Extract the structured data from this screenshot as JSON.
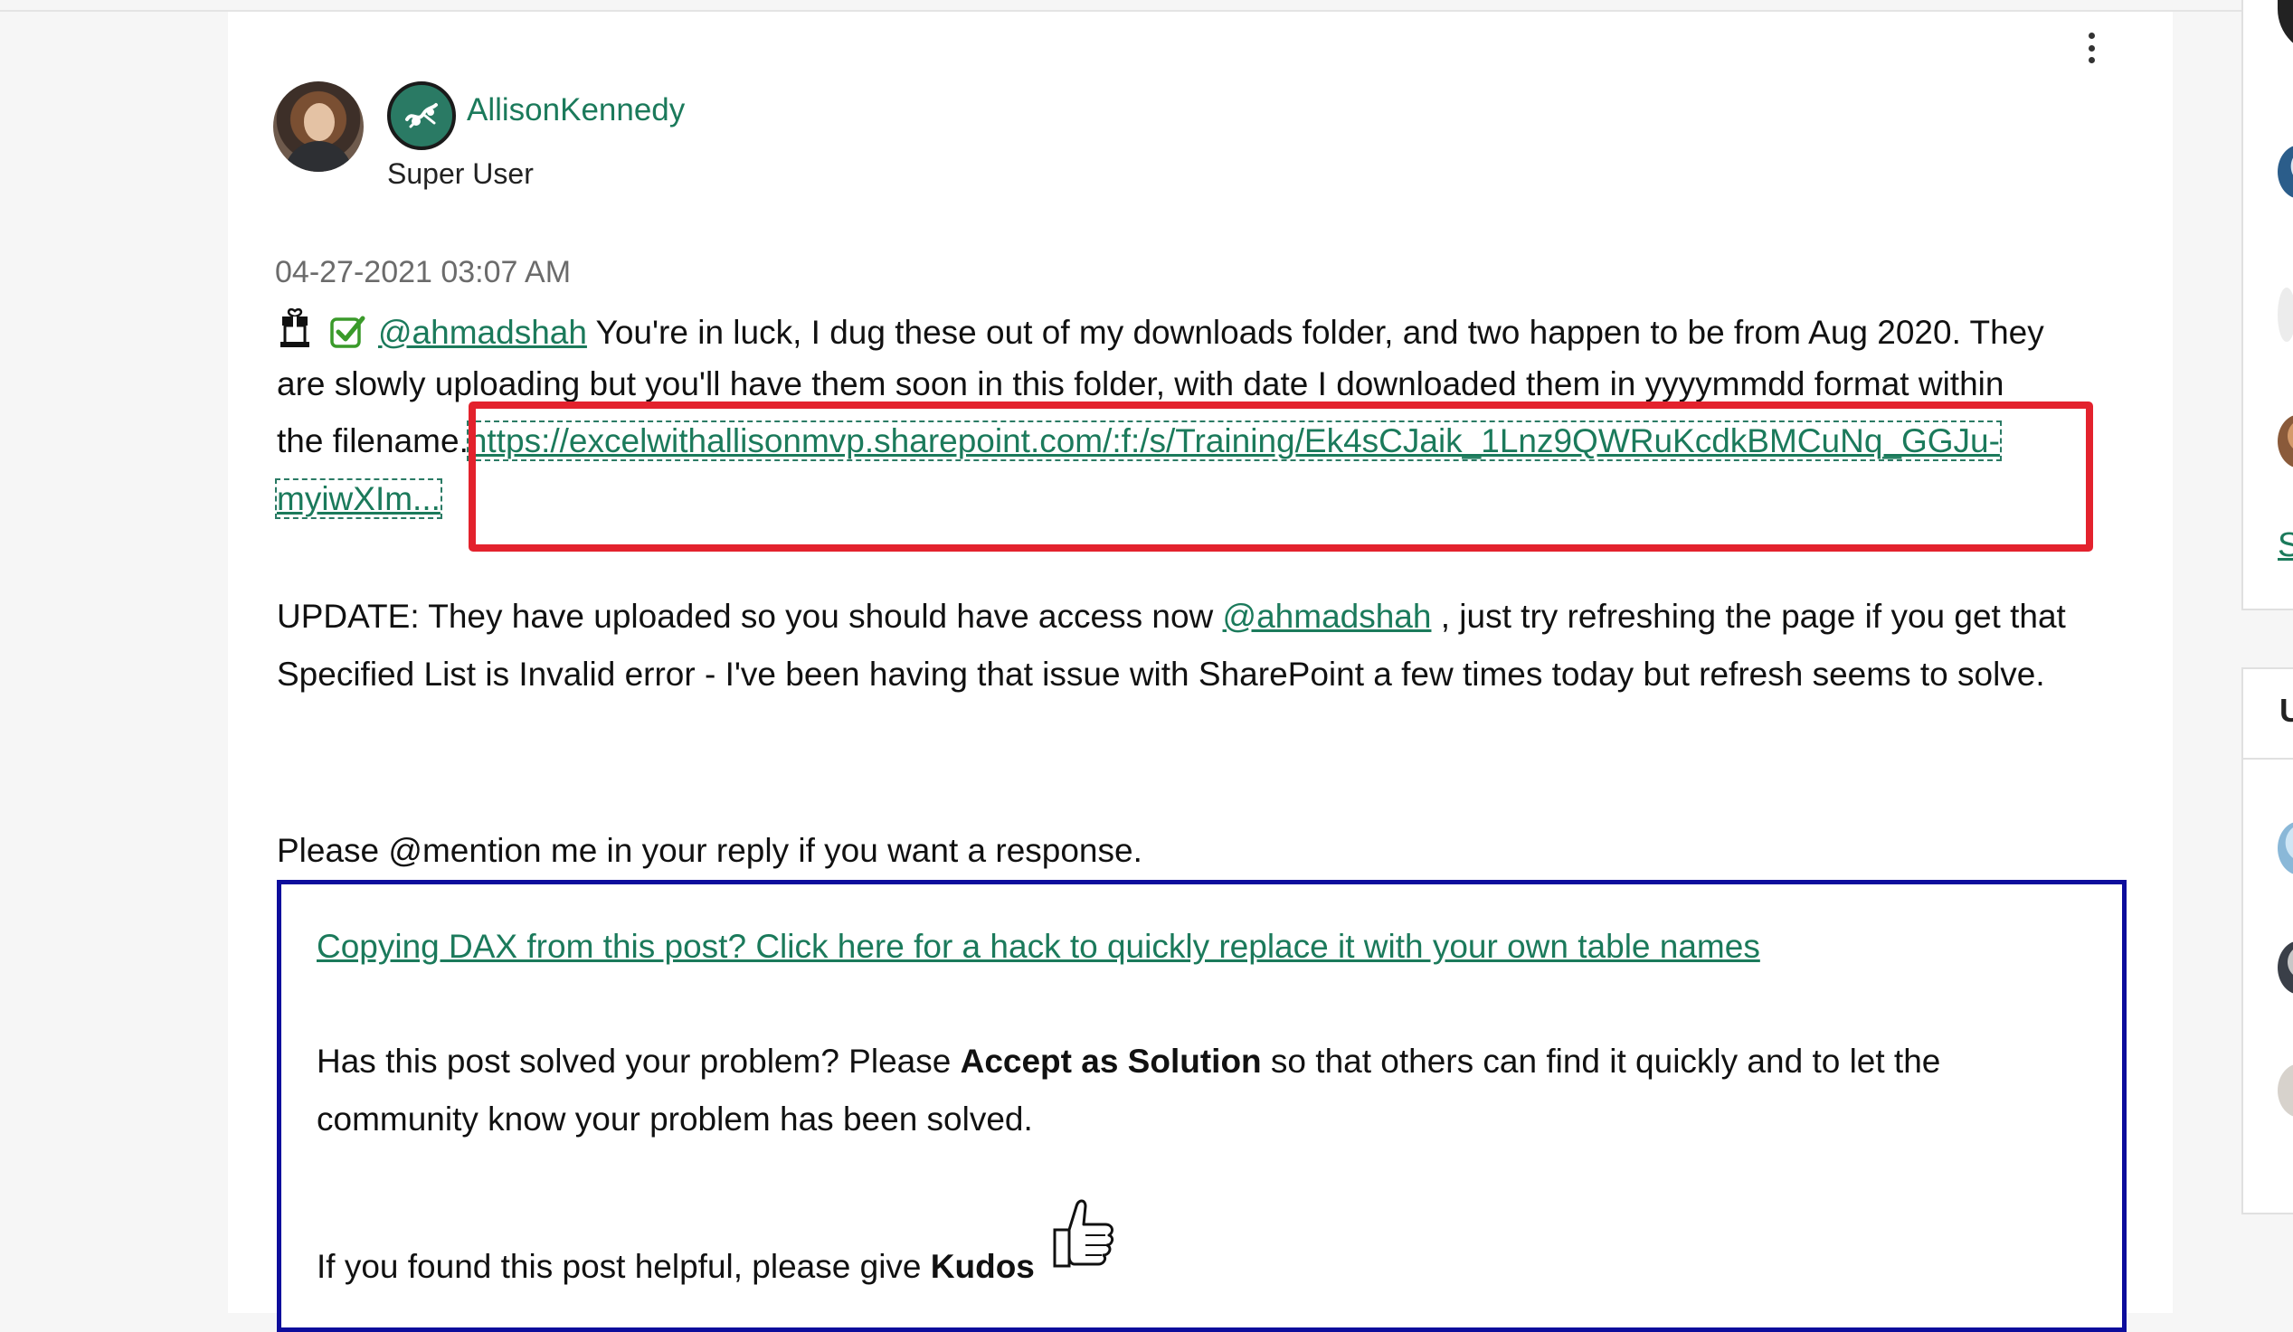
{
  "post": {
    "author_name": "AllisonKennedy",
    "author_rank": "Super User",
    "date": "04-27-2021 03:07 AM",
    "mention_1": "@ahmadshah",
    "line1_text": " You're in luck, I dug these out of my downloads folder, and two happen to be from Aug 2020. They",
    "line2_text": "are slowly uploading but you'll have them soon in this folder, with date I downloaded them in  yyyymmdd format within",
    "line3_prefix": "the filename.",
    "link_part1": "https://excelwithallisonmvp.sharepoint.com/:f:/s/Training/Ek4sCJaik_1Lnz9QWRuKcdkBMCuNq_GGJu-",
    "link_part2": "myiwXIm...",
    "update_prefix": "UPDATE: They have uploaded so you should have access now ",
    "mention_2": "@ahmadshah",
    "update_suffix": " , just try refreshing the page if you get that",
    "update_line2": "Specified List is Invalid error - I've been having that issue with SharePoint a few times today but refresh seems to solve.",
    "mention_request": "Please @mention me in your reply if you want a response."
  },
  "signature": {
    "dax_link": "Copying DAX from this post? Click here for a hack to quickly replace it with your own table names",
    "solved_prefix": "Has this post solved your problem? Please ",
    "solved_bold": "Accept as Solution",
    "solved_suffix": " so that others can find it quickly and to let the",
    "solved_line2": "community know your problem has been solved.",
    "kudos_prefix": "If you found this post helpful, please give ",
    "kudos_bold": "Kudos"
  },
  "sidebar": {
    "letter_link": "S",
    "letter_heading": "U"
  },
  "icons": {
    "options": "more-options-icon",
    "gift": "gift-icon",
    "check": "checkbox-checked-icon",
    "rank": "rank-badge-icon",
    "thumb": "thumbs-up-icon"
  },
  "colors": {
    "link": "#1b7a5b",
    "highlight_box": "#e3222d",
    "signature_border": "#0d0d9c"
  }
}
